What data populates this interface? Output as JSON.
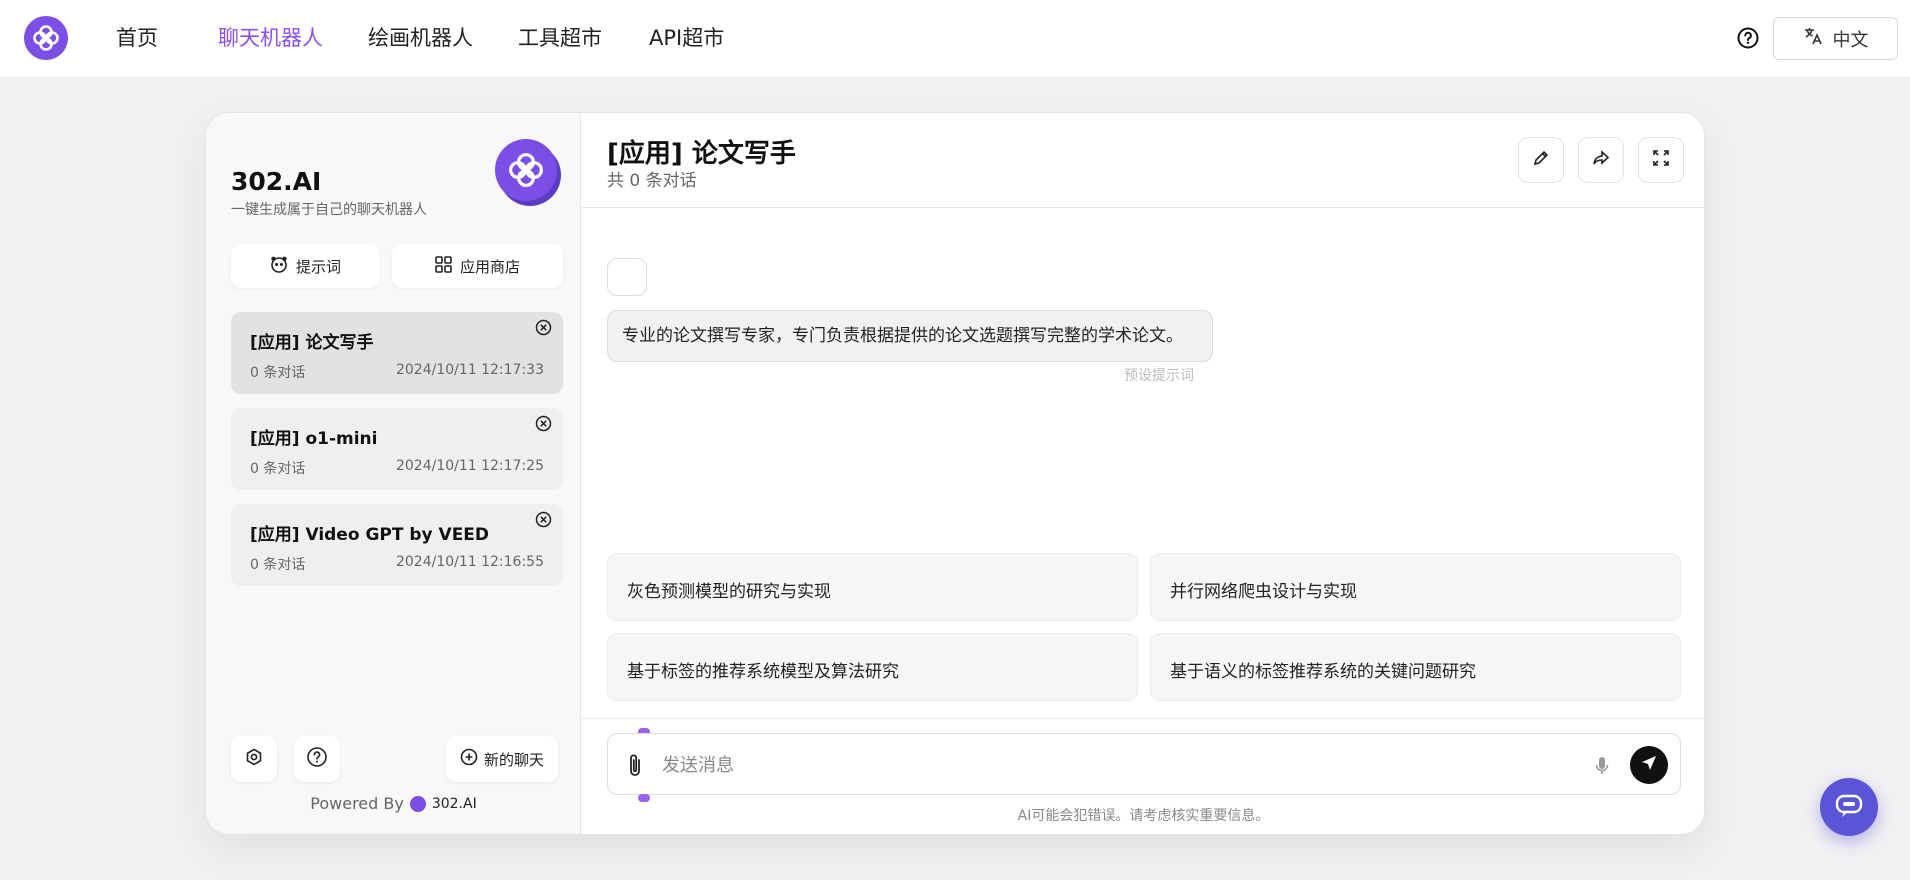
{
  "nav": {
    "items": [
      "首页",
      "聊天机器人",
      "绘画机器人",
      "工具超市",
      "API超市"
    ],
    "active_index": 1,
    "language": "中文"
  },
  "sidebar": {
    "brand_title": "302.AI",
    "brand_subtitle": "一键生成属于自己的聊天机器人",
    "prompt_button": "提示词",
    "store_button": "应用商店",
    "sessions": [
      {
        "title": "[应用] 论文写手",
        "count": "0 条对话",
        "time": "2024/10/11 12:17:33",
        "active": true
      },
      {
        "title": "[应用] o1-mini",
        "count": "0 条对话",
        "time": "2024/10/11 12:17:25",
        "active": false
      },
      {
        "title": "[应用] Video GPT by VEED",
        "count": "0 条对话",
        "time": "2024/10/11 12:16:55",
        "active": false
      }
    ],
    "new_chat": "新的聊天",
    "powered_by": "Powered By",
    "powered_brand": "302.AI"
  },
  "chat": {
    "title": "[应用] 论文写手",
    "subtitle": "共 0 条对话",
    "message": "专业的论文撰写专家，专门负责根据提供的论文选题撰写完整的学术论文。",
    "message_hint": "预设提示词",
    "suggestions": [
      "灰色预测模型的研究与实现",
      "并行网络爬虫设计与实现",
      "基于标签的推荐系统模型及算法研究",
      "基于语义的标签推荐系统的关键问题研究"
    ],
    "input_placeholder": "发送消息",
    "disclaimer": "AI可能会犯错误。请考虑核实重要信息。"
  },
  "colors": {
    "accent": "#8a4ff0",
    "brand": "#7b4ee6",
    "float": "#5a55d6"
  }
}
